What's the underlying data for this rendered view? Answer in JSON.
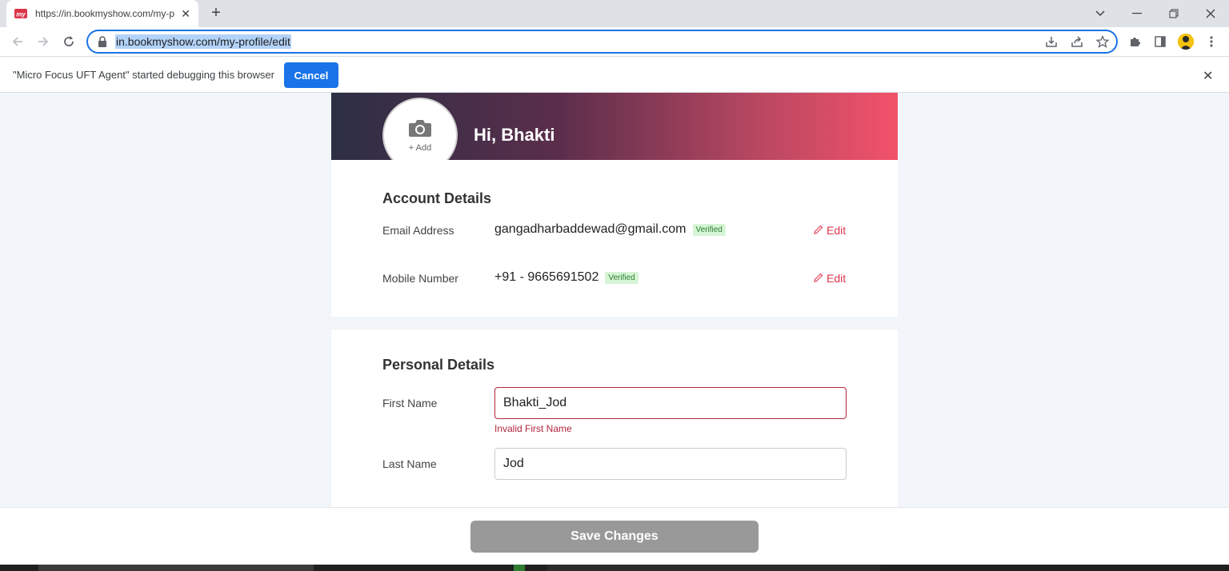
{
  "browser": {
    "tab_title": "https://in.bookmyshow.com/my-profile/edit",
    "url": "in.bookmyshow.com/my-profile/edit",
    "new_tab_symbol": "+",
    "tab_close_symbol": "✕"
  },
  "infobar": {
    "message": "\"Micro Focus UFT Agent\" started debugging this browser",
    "cancel_label": "Cancel",
    "close_symbol": "✕"
  },
  "profile": {
    "greeting": "Hi, Bhakti",
    "add_photo_label": "+ Add"
  },
  "account": {
    "title": "Account Details",
    "email_label": "Email Address",
    "email_value": "gangadharbaddewad@gmail.com",
    "email_status": "Verified",
    "mobile_label": "Mobile Number",
    "mobile_value": "+91 - 9665691502",
    "mobile_status": "Verified",
    "edit_label": "Edit"
  },
  "personal": {
    "title": "Personal Details",
    "first_name_label": "First Name",
    "first_name_value": "Bhakti_Jod",
    "first_name_error": "Invalid First Name",
    "last_name_label": "Last Name",
    "last_name_value": "Jod"
  },
  "footer": {
    "save_label": "Save Changes"
  },
  "colors": {
    "accent": "#dc354b",
    "chrome_blue": "#1a73e8",
    "error": "#b3263d",
    "verified_green": "#2e7d32"
  }
}
